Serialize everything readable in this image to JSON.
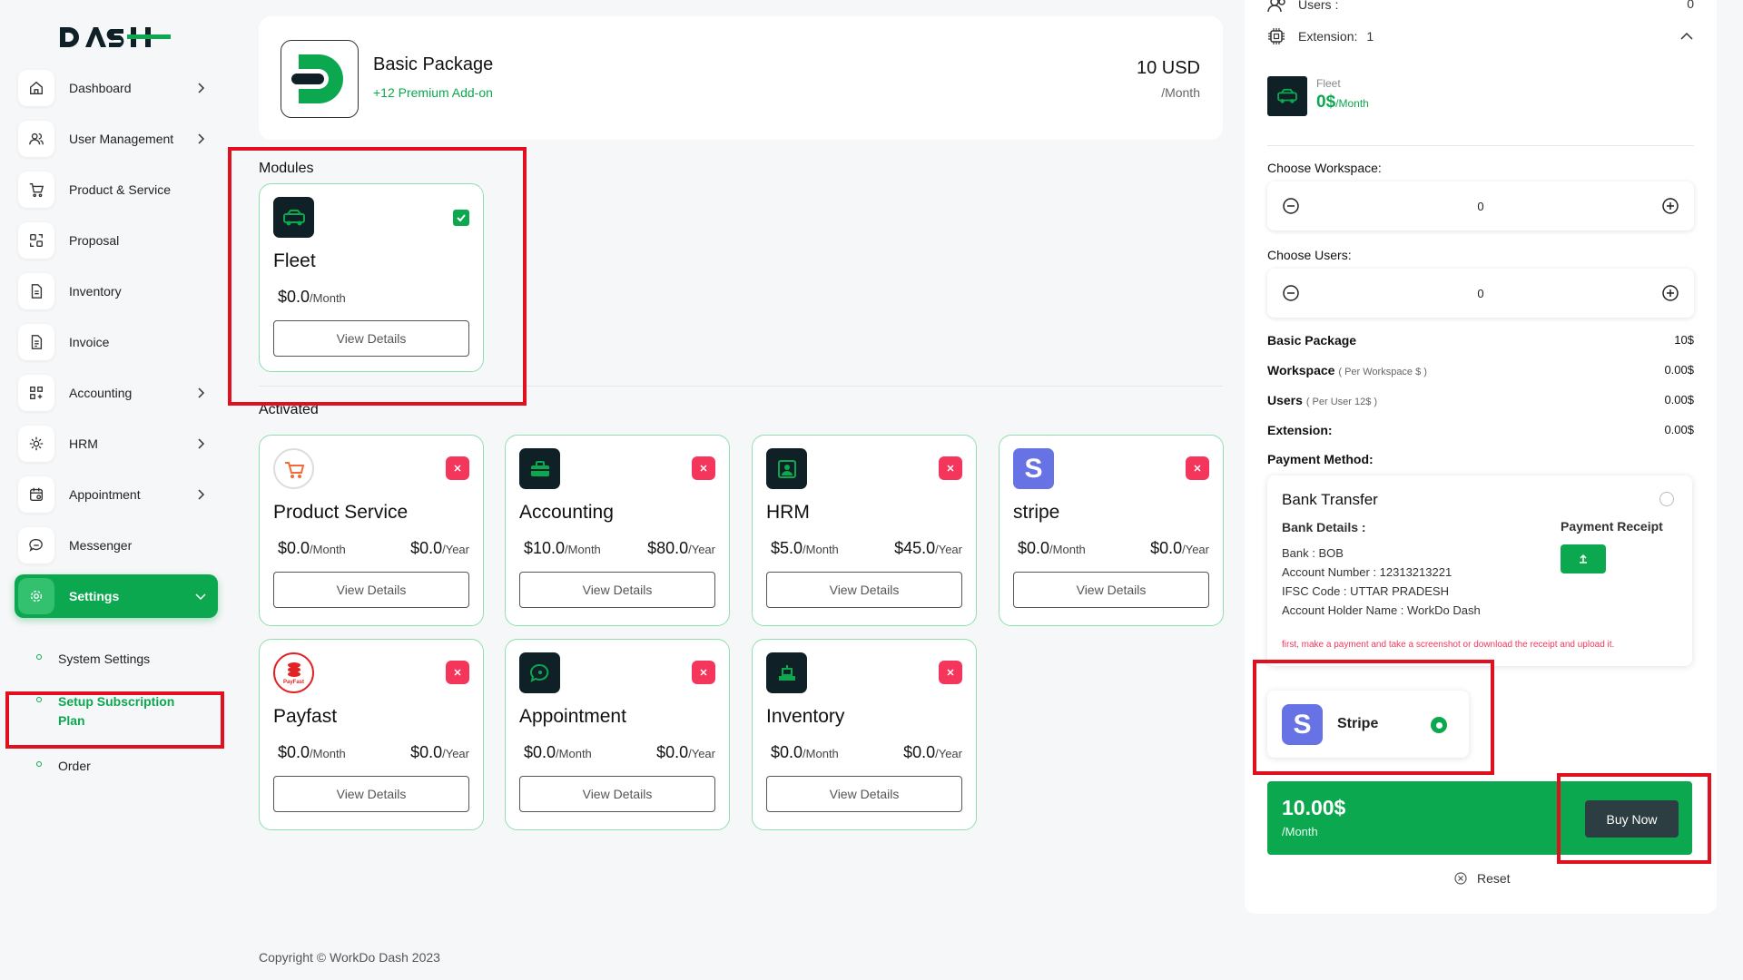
{
  "brand": {
    "logo_text": "DASH"
  },
  "sidebar": {
    "items": [
      {
        "label": "Dashboard",
        "icon": "home-icon",
        "chevron": true
      },
      {
        "label": "User Management",
        "icon": "users-icon",
        "chevron": true
      },
      {
        "label": "Product & Service",
        "icon": "cart-icon",
        "chevron": false
      },
      {
        "label": "Proposal",
        "icon": "proposal-icon",
        "chevron": false
      },
      {
        "label": "Inventory",
        "icon": "file-icon",
        "chevron": false
      },
      {
        "label": "Invoice",
        "icon": "invoice-icon",
        "chevron": false
      },
      {
        "label": "Accounting",
        "icon": "grid-icon",
        "chevron": true
      },
      {
        "label": "HRM",
        "icon": "hrm-icon",
        "chevron": true
      },
      {
        "label": "Appointment",
        "icon": "calendar-icon",
        "chevron": true
      },
      {
        "label": "Messenger",
        "icon": "chat-icon",
        "chevron": false
      },
      {
        "label": "Settings",
        "icon": "gear-icon",
        "chevron": true
      }
    ],
    "sub_items": [
      {
        "label": "System Settings"
      },
      {
        "label": "Setup Subscription Plan"
      },
      {
        "label": "Order"
      }
    ]
  },
  "package": {
    "name": "Basic Package",
    "addon": "+12 Premium Add-on",
    "price": "10 USD",
    "period": "/Month"
  },
  "sections": {
    "modules": "Modules",
    "activated": "Activated"
  },
  "modules": [
    {
      "name": "Fleet",
      "monthly": "$0.0",
      "month_unit": "/Month",
      "view": "View Details"
    }
  ],
  "activated": [
    {
      "name": "Product Service",
      "monthly": "$0.0",
      "yearly": "$0.0",
      "month_unit": "/Month",
      "year_unit": "/Year",
      "view": "View Details"
    },
    {
      "name": "Accounting",
      "monthly": "$10.0",
      "yearly": "$80.0",
      "month_unit": "/Month",
      "year_unit": "/Year",
      "view": "View Details"
    },
    {
      "name": "HRM",
      "monthly": "$5.0",
      "yearly": "$45.0",
      "month_unit": "/Month",
      "year_unit": "/Year",
      "view": "View Details"
    },
    {
      "name": "stripe",
      "monthly": "$0.0",
      "yearly": "$0.0",
      "month_unit": "/Month",
      "year_unit": "/Year",
      "view": "View Details"
    },
    {
      "name": "Payfast",
      "monthly": "$0.0",
      "yearly": "$0.0",
      "month_unit": "/Month",
      "year_unit": "/Year",
      "view": "View Details"
    },
    {
      "name": "Appointment",
      "monthly": "$0.0",
      "yearly": "$0.0",
      "month_unit": "/Month",
      "year_unit": "/Year",
      "view": "View Details"
    },
    {
      "name": "Inventory",
      "monthly": "$0.0",
      "yearly": "$0.0",
      "month_unit": "/Month",
      "year_unit": "/Year",
      "view": "View Details"
    }
  ],
  "payfast_logo_text": "PayFast",
  "panel": {
    "users_label": "Users :",
    "users_value": "0",
    "extension_label": "Extension:",
    "extension_value": "1",
    "ext_item_name": "Fleet",
    "ext_item_price": "0$",
    "ext_item_unit": "/Month",
    "workspace_label": "Choose Workspace:",
    "workspace_value": "0",
    "users_choose_label": "Choose Users:",
    "users_choose_value": "0",
    "summary": [
      {
        "label": "Basic Package",
        "note": "",
        "value": "10$"
      },
      {
        "label": "Workspace",
        "note": "( Per Workspace $ )",
        "value": "0.00$"
      },
      {
        "label": "Users",
        "note": "( Per User 12$ )",
        "value": "0.00$"
      },
      {
        "label": "Extension:",
        "note": "",
        "value": "0.00$"
      }
    ],
    "payment_method_label": "Payment Method:",
    "bank": {
      "title": "Bank Transfer",
      "details_label": "Bank Details :",
      "receipt_label": "Payment Receipt",
      "lines": [
        "Bank : BOB",
        "Account Number : 12313213221",
        "IFSC Code : UTTAR PRADESH",
        "Account Holder Name : WorkDo Dash"
      ],
      "note": "first, make a payment and take a screenshot or download the receipt and upload it."
    },
    "stripe_label": "Stripe",
    "total": "10.00$",
    "total_unit": "/Month",
    "buy_now": "Buy Now",
    "reset": "Reset"
  },
  "footer": {
    "copyright": "Copyright © WorkDo Dash 2023"
  },
  "colors": {
    "accent": "#0ca84f",
    "danger": "#f5365c",
    "dark": "#0f2027",
    "stripe": "#6772e5",
    "highlight": "#e0101e"
  }
}
